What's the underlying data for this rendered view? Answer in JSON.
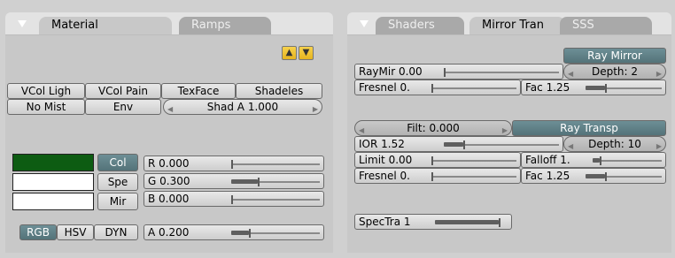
{
  "material_panel": {
    "tabs": [
      {
        "label": "Material"
      },
      {
        "label": "Ramps"
      }
    ],
    "shading_flags": [
      "VCol Ligh",
      "VCol Pain",
      "TexFace",
      "Shadeles"
    ],
    "no_mist": "No Mist",
    "env": "Env",
    "shad_a": "Shad A 1.000",
    "color_targets": [
      "Col",
      "Spe",
      "Mir"
    ],
    "sliders": [
      {
        "label": "R 0.000",
        "value": 0.0
      },
      {
        "label": "G 0.300",
        "value": 0.3
      },
      {
        "label": "B 0.000",
        "value": 0.0
      },
      {
        "label": "A 0.200",
        "value": 0.2
      }
    ],
    "color_modes": [
      "RGB",
      "HSV",
      "DYN"
    ],
    "swatch_colors": [
      "#0d5c12",
      "#ffffff",
      "#ffffff"
    ]
  },
  "shaders_panel": {
    "tabs": [
      {
        "label": "Shaders"
      },
      {
        "label": "Mirror Tran"
      },
      {
        "label": "SSS"
      }
    ],
    "ray_mirror": "Ray Mirror",
    "raymir": {
      "label": "RayMir 0.00",
      "value": 0.0
    },
    "depth_mirror": "Depth: 2",
    "fresnel_mirror": {
      "label": "Fresnel 0.",
      "value": 0.0
    },
    "fac_mirror": {
      "label": "Fac 1.25",
      "value": 0.25
    },
    "filt": "Filt: 0.000",
    "ray_transp": "Ray Transp",
    "ior": {
      "label": "IOR 1.52",
      "value": 0.17
    },
    "depth_transp": "Depth: 10",
    "limit": {
      "label": "Limit 0.00",
      "value": 0.0
    },
    "falloff": {
      "label": "Falloff 1.",
      "value": 0.1
    },
    "fresnel_transp": {
      "label": "Fresnel 0.",
      "value": 0.0
    },
    "fac_transp": {
      "label": "Fac 1.25",
      "value": 0.25
    },
    "spectra": {
      "label": "SpecTra 1",
      "value": 1.0
    }
  },
  "colors": {
    "active_button": "#5f7f86",
    "mini_buttons": "#f0c435"
  },
  "icons": {
    "collapse": "triangle-down-icon",
    "copy": "arrow-up-icon",
    "paste": "arrow-down-icon"
  }
}
